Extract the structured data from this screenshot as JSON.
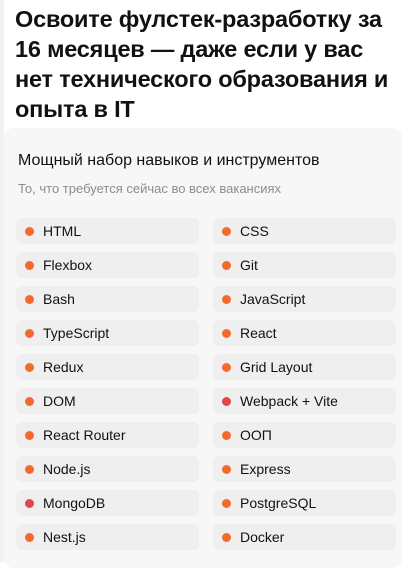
{
  "headline": "Освоите фулстек-разработку за 16 месяцев — даже если у вас нет технического образования и опыта в IT",
  "card": {
    "title": "Мощный набор навыков и инструментов",
    "subtitle": "То, что требуется сейчас во всех вакансиях"
  },
  "colors": {
    "dot_orange": "#f26a2e",
    "dot_red": "#e0474c"
  },
  "skills": [
    {
      "label": "HTML",
      "dot": "orange"
    },
    {
      "label": "CSS",
      "dot": "orange"
    },
    {
      "label": "Flexbox",
      "dot": "orange"
    },
    {
      "label": "Git",
      "dot": "orange"
    },
    {
      "label": "Bash",
      "dot": "orange"
    },
    {
      "label": "JavaScript",
      "dot": "orange"
    },
    {
      "label": "TypeScript",
      "dot": "orange"
    },
    {
      "label": "React",
      "dot": "orange"
    },
    {
      "label": "Redux",
      "dot": "orange"
    },
    {
      "label": "Grid Layout",
      "dot": "orange"
    },
    {
      "label": "DOM",
      "dot": "orange"
    },
    {
      "label": "Webpack + Vite",
      "dot": "red"
    },
    {
      "label": "React Router",
      "dot": "orange"
    },
    {
      "label": "ООП",
      "dot": "orange"
    },
    {
      "label": "Node.js",
      "dot": "orange"
    },
    {
      "label": "Express",
      "dot": "orange"
    },
    {
      "label": "MongoDB",
      "dot": "red"
    },
    {
      "label": "PostgreSQL",
      "dot": "orange"
    },
    {
      "label": "Nest.js",
      "dot": "orange"
    },
    {
      "label": "Docker",
      "dot": "orange"
    }
  ]
}
